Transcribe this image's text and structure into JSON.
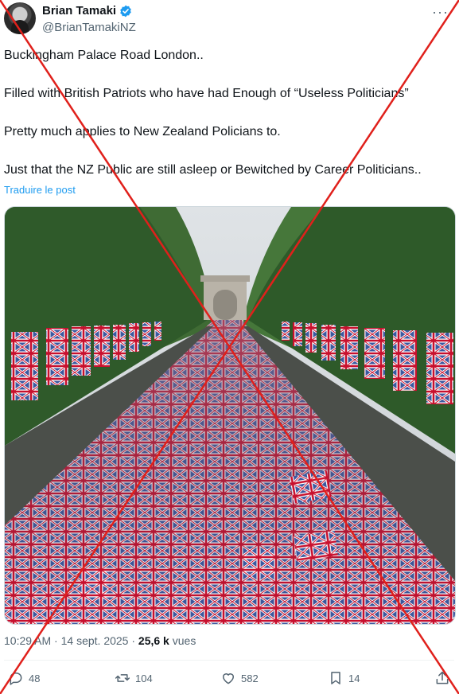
{
  "author": {
    "display_name": "Brian Tamaki",
    "handle": "@BrianTamakiNZ"
  },
  "tweet": {
    "lines": [
      "Buckingham Palace Road London..",
      "Filled with British Patriots who have had Enough of “Useless Politicians”",
      "Pretty much applies to New Zealand Policians to.",
      "Just that the NZ Public are still asleep or Bewitched by Career Politicians.."
    ],
    "translate_label": "Traduire le post"
  },
  "meta": {
    "time": "10:29 AM",
    "date": "14 sept. 2025",
    "views_count": "25,6 k",
    "views_label": "vues"
  },
  "actions": {
    "replies": "48",
    "reposts": "104",
    "likes": "582",
    "bookmarks": "14"
  },
  "colors": {
    "accent": "#1d9bf0",
    "cross": "#e0201b",
    "verified": "#1d9bf0"
  },
  "icons": [
    "verified-badge-icon",
    "more-icon",
    "reply-icon",
    "repost-icon",
    "like-icon",
    "bookmark-icon",
    "share-icon"
  ]
}
